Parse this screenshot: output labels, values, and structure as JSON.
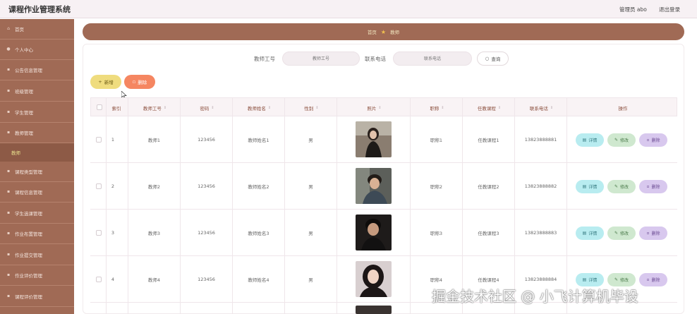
{
  "app": {
    "title": "课程作业管理系统",
    "user": "管理员 abo",
    "logout": "退出登录"
  },
  "sidebar": {
    "items": [
      {
        "label": "首页",
        "icon": "home-icon"
      },
      {
        "label": "个人中心",
        "icon": "user-icon"
      },
      {
        "label": "公告信息管理",
        "icon": "menu-icon"
      },
      {
        "label": "班级管理",
        "icon": "menu-icon"
      },
      {
        "label": "学生管理",
        "icon": "menu-icon"
      },
      {
        "label": "教师管理",
        "icon": "menu-icon"
      },
      {
        "label": "课程类型管理",
        "icon": "menu-icon"
      },
      {
        "label": "课程信息管理",
        "icon": "menu-icon"
      },
      {
        "label": "学生选课管理",
        "icon": "menu-icon"
      },
      {
        "label": "作业布置管理",
        "icon": "menu-icon"
      },
      {
        "label": "作业提交管理",
        "icon": "menu-icon"
      },
      {
        "label": "作业评价管理",
        "icon": "menu-icon"
      },
      {
        "label": "课程评价管理",
        "icon": "menu-icon"
      }
    ],
    "active_sub": "教师"
  },
  "breadcrumb": {
    "home": "首页",
    "current": "教师"
  },
  "search": {
    "field1_label": "教师工号",
    "field1_placeholder": "教师工号",
    "field2_label": "联系电话",
    "field2_placeholder": "联系电话",
    "button": "查询"
  },
  "toolbar": {
    "add": "新增",
    "delete": "删除"
  },
  "table": {
    "columns": [
      "索引",
      "教师工号",
      "密码",
      "教师姓名",
      "性别",
      "照片",
      "职称",
      "任教课程",
      "联系电话",
      "操作"
    ],
    "rows": [
      {
        "idx": "1",
        "id": "教师1",
        "pwd": "123456",
        "name": "教师姓名1",
        "sex": "男",
        "title": "职称1",
        "course": "任教课程1",
        "phone": "13823888881"
      },
      {
        "idx": "2",
        "id": "教师2",
        "pwd": "123456",
        "name": "教师姓名2",
        "sex": "男",
        "title": "职称2",
        "course": "任教课程2",
        "phone": "13823888882"
      },
      {
        "idx": "3",
        "id": "教师3",
        "pwd": "123456",
        "name": "教师姓名3",
        "sex": "男",
        "title": "职称3",
        "course": "任教课程3",
        "phone": "13823888883"
      },
      {
        "idx": "4",
        "id": "教师4",
        "pwd": "123456",
        "name": "教师姓名4",
        "sex": "男",
        "title": "职称4",
        "course": "任教课程4",
        "phone": "13823888884"
      }
    ],
    "actions": {
      "detail": "详情",
      "edit": "修改",
      "remove": "删除"
    }
  },
  "watermark": "掘金技术社区 @ 小飞计算机毕设",
  "colors": {
    "sidebar": "#a06a55",
    "add": "#efdc7e",
    "delete": "#f58661",
    "detail": "#b8ecf0",
    "edit": "#cfe8cf",
    "remove": "#d8c8ee"
  }
}
